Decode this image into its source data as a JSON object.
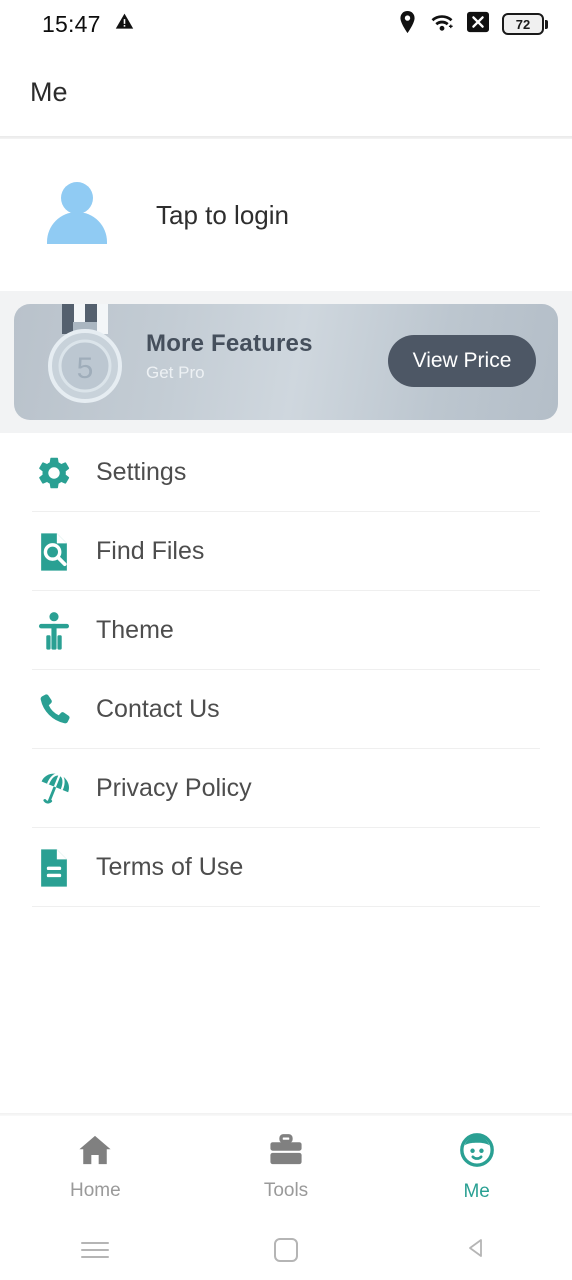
{
  "statusbar": {
    "time": "15:47",
    "warning_icon": "warning-triangle-icon",
    "location_icon": "location-pin-icon",
    "wifi_icon": "wifi-icon",
    "nosim_icon": "x-in-box-icon",
    "battery_level": "72"
  },
  "header": {
    "title": "Me"
  },
  "profile": {
    "avatar_icon": "person-avatar-icon",
    "login_text": "Tap to login",
    "avatar_color": "#90cbf3"
  },
  "promo": {
    "medal_icon": "medal-icon",
    "medal_number": "5",
    "title": "More Features",
    "subtitle": "Get Pro",
    "button_label": "View Price",
    "button_color": "#4d5765",
    "card_color": "#c3ccd4"
  },
  "menu": {
    "accent_color": "#2aa093",
    "items": [
      {
        "label": "Settings",
        "icon": "gear-icon"
      },
      {
        "label": "Find Files",
        "icon": "file-search-icon"
      },
      {
        "label": "Theme",
        "icon": "accessibility-person-icon"
      },
      {
        "label": "Contact Us",
        "icon": "phone-icon"
      },
      {
        "label": "Privacy Policy",
        "icon": "umbrella-icon"
      },
      {
        "label": "Terms of Use",
        "icon": "document-lines-icon"
      }
    ]
  },
  "bottomnav": {
    "active_color": "#2aa093",
    "inactive_color": "#9a9a9a",
    "items": [
      {
        "label": "Home",
        "icon": "home-icon",
        "active": false
      },
      {
        "label": "Tools",
        "icon": "briefcase-icon",
        "active": false
      },
      {
        "label": "Me",
        "icon": "face-icon",
        "active": true
      }
    ]
  },
  "androidnav": {
    "recents_icon": "menu-lines-icon",
    "home_icon": "rounded-square-icon",
    "back_icon": "back-triangle-icon"
  }
}
